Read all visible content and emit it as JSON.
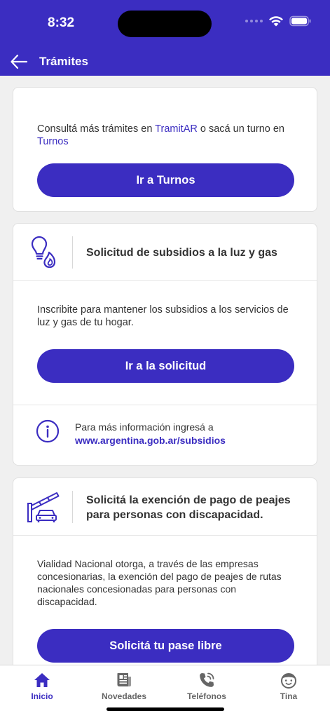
{
  "status": {
    "time": "8:32"
  },
  "nav": {
    "title": "Trámites"
  },
  "card_turnos": {
    "text_prefix": "Consultá más trámites en ",
    "link_tramitar": "TramitAR",
    "text_middle": " o sacá un turno en ",
    "link_turnos": "Turnos",
    "button": "Ir a Turnos"
  },
  "card_subsidios": {
    "title": "Solicitud de subsidios a la luz y gas",
    "description": "Inscribite para mantener los subsidios a los servicios de luz y gas de tu hogar.",
    "button": "Ir a la solicitud",
    "info_text": "Para más información ingresá a",
    "info_link": "www.argentina.gob.ar/subsidios"
  },
  "card_peajes": {
    "title": "Solicitá la exención de pago de peajes para personas con discapacidad.",
    "description": "Vialidad Nacional otorga, a través de las empresas concesionarias, la exención del pago de peajes de rutas nacionales concesionadas para personas con discapacidad.",
    "button": "Solicitá tu pase libre"
  },
  "tabs": [
    {
      "label": "Inicio",
      "icon": "home-icon",
      "active": true
    },
    {
      "label": "Novedades",
      "icon": "newspaper-icon",
      "active": false
    },
    {
      "label": "Teléfonos",
      "icon": "phone-icon",
      "active": false
    },
    {
      "label": "Tina",
      "icon": "tina-icon",
      "active": false
    }
  ],
  "colors": {
    "primary": "#3b2dc1",
    "background": "#f0f0f0",
    "text": "#333333"
  }
}
